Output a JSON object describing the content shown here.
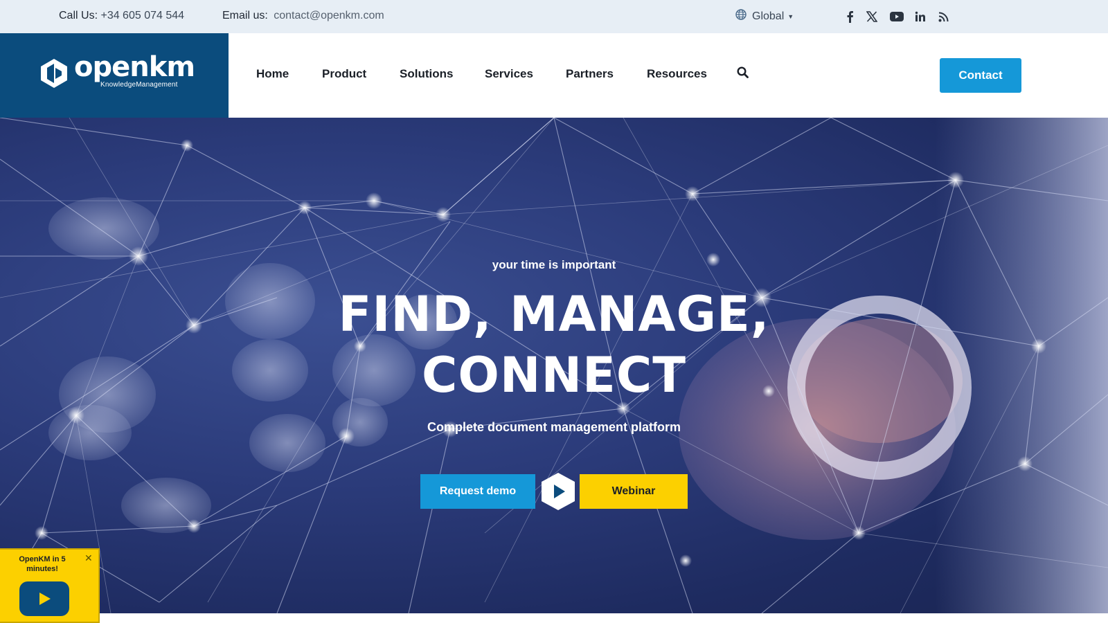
{
  "topbar": {
    "phone_label": "Call Us:",
    "phone_value": "+34 605 074 544",
    "email_label": "Email us:",
    "email_value": "contact@openkm.com",
    "region_label": "Global",
    "region_icon": "globe-icon",
    "social_icons": [
      "facebook-icon",
      "x-icon",
      "youtube-icon",
      "linkedin-icon",
      "rss-icon"
    ]
  },
  "header": {
    "logo_text": "openkm",
    "logo_tagline": "KnowledgeManagement",
    "nav": [
      "Home",
      "Product",
      "Solutions",
      "Services",
      "Partners",
      "Resources"
    ],
    "search_icon": "search-icon",
    "contact_label": "Contact"
  },
  "hero": {
    "subtitle": "your time is important",
    "title_line1": "FIND, MANAGE,",
    "title_line2": "CONNECT",
    "description": "Complete document management platform",
    "demo_label": "Request demo",
    "webinar_label": "Webinar",
    "play_icon": "play-icon"
  },
  "popup": {
    "text": "OpenKM in 5 minutes!",
    "close_icon": "close-icon",
    "play_icon": "play-icon"
  },
  "colors": {
    "brand_blue": "#0b4c7d",
    "accent_blue": "#1598d8",
    "accent_yellow": "#fcd000",
    "topbar_bg": "#e7eef5"
  }
}
